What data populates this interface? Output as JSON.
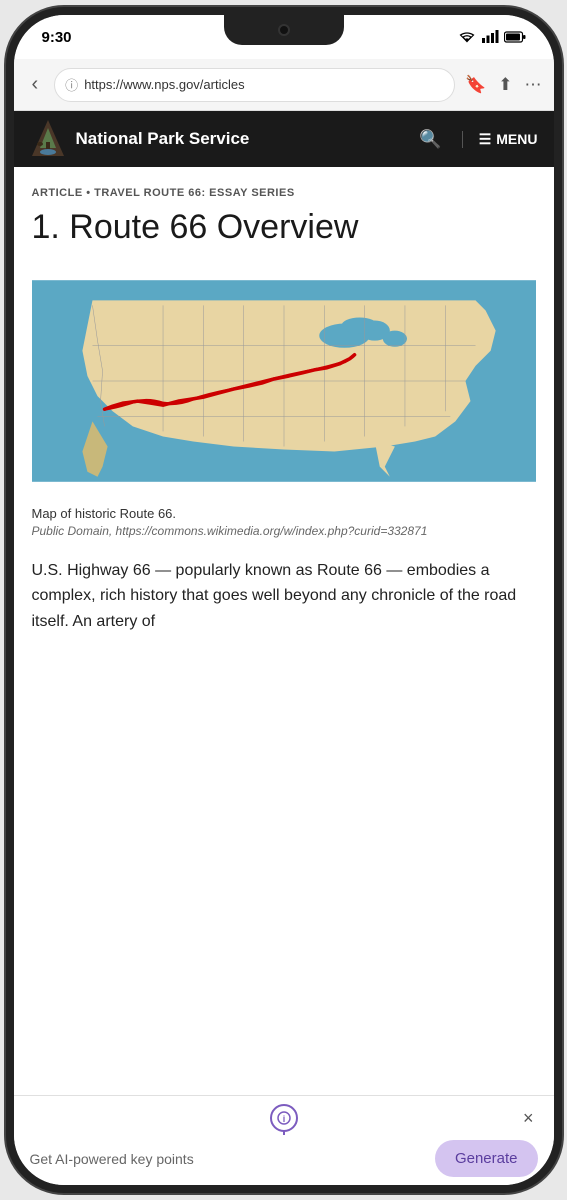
{
  "status": {
    "time": "9:30"
  },
  "browser": {
    "back_label": "‹",
    "url": "https://www.nps.gov/articles",
    "bookmark_icon": "bookmark",
    "share_icon": "share",
    "more_icon": "more"
  },
  "navbar": {
    "title": "National Park Service",
    "search_icon": "search",
    "menu_label": "MENU"
  },
  "article": {
    "category": "ARTICLE • TRAVEL ROUTE 66: ESSAY SERIES",
    "title": "1. Route 66 Overview",
    "map_caption": "Map of historic Route 66.",
    "map_attribution": "Public Domain, https://commons.wikimedia.org/w/index.php?curid=332871",
    "body": "U.S. Highway 66 — popularly known as Route 66 — embodies a complex, rich history that goes well beyond any chronicle of the road itself. An artery of"
  },
  "ai_bar": {
    "label": "Get AI-powered key points",
    "generate_label": "Generate",
    "close_label": "×"
  }
}
